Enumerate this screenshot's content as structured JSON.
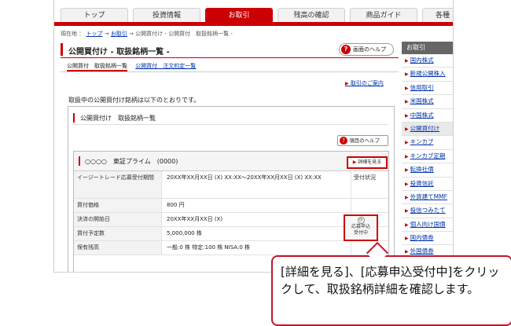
{
  "tabs": [
    "トップ",
    "投資情報",
    "お取引",
    "残高の確認",
    "商品ガイド",
    "各種"
  ],
  "active_tab": "お取引",
  "breadcrumb": {
    "prefix": "現在地 ：",
    "top": "トップ",
    "arrow1": "→",
    "trade": "お取引",
    "arrow2": "→",
    "rest": "公開買付け - 公開買付　取扱銘柄一覧 -"
  },
  "page_title": "公開買付け - 取扱銘柄一覧 -",
  "help_button": "画面のヘルプ",
  "subtabs": {
    "active": "公開買付　取扱銘柄一覧",
    "link": "公開買付　注文約定一覧"
  },
  "guide_link": "取引のご案内",
  "intro_text": "取扱中の公開買付け銘柄は以下のとおりです。",
  "panel": {
    "title": "公開買付け　取扱銘柄一覧",
    "help_button": "項目のヘルプ"
  },
  "stock": {
    "name": "○○○○　東証プライム　(0000)",
    "detail_button": "詳細を見る",
    "rows": [
      {
        "label": "イージートレード応募受付期間",
        "value": "20XX年XX月XX日 (X) XX:XX～20XX年XX月XX日 (X) XX:XX",
        "status": "受付状況"
      },
      {
        "label": "買付価格",
        "value": "800 円",
        "status": ""
      },
      {
        "label": "決済の開始日",
        "value": "20XX年XX月XX日 (X)",
        "status": ""
      },
      {
        "label": "買付予定数",
        "value": "5,000,000 株",
        "status": ""
      },
      {
        "label": "保有残高",
        "value": "一般:0 株 特定:100 株 NISA:0 株",
        "status": ""
      }
    ],
    "apply_button": {
      "line1": "応募申込",
      "line2": "受付中"
    }
  },
  "sidebar": {
    "header": "お取引",
    "items": [
      "国内株式",
      "新規公開株入",
      "信用取引",
      "米国株式",
      "中国株式",
      "公開買付け",
      "キンカブ",
      "キンカブ定期",
      "転換社債",
      "投資信託",
      "外貨建てMMF",
      "投信つみたて",
      "個人向け国債",
      "国内債券",
      "外国債券"
    ],
    "active_index": 5
  },
  "callout_text": "[詳細を見る]、[応募申込受付中]をクリックして、取扱銘柄詳細を確認します。",
  "colors": {
    "accent": "#cc0000",
    "callout_border": "#c4152c",
    "link": "#0033aa"
  }
}
